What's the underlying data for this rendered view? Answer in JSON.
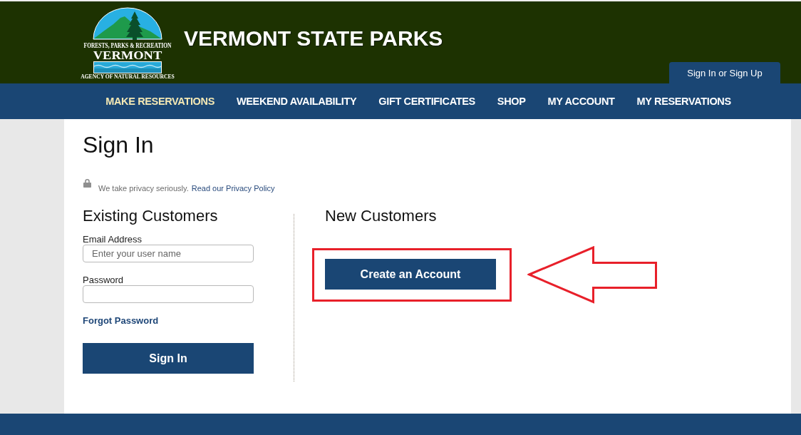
{
  "header": {
    "logo_lines": [
      "FORESTS, PARKS & RECREATION",
      "VERMONT",
      "AGENCY OF NATURAL RESOURCES"
    ],
    "title": "VERMONT STATE PARKS",
    "account_tab": "Sign In or Sign Up"
  },
  "nav": [
    {
      "label": "MAKE RESERVATIONS",
      "selected": true
    },
    {
      "label": "WEEKEND AVAILABILITY",
      "selected": false
    },
    {
      "label": "GIFT CERTIFICATES",
      "selected": false
    },
    {
      "label": "SHOP",
      "selected": false
    },
    {
      "label": "MY ACCOUNT",
      "selected": false
    },
    {
      "label": "MY RESERVATIONS",
      "selected": false
    }
  ],
  "page": {
    "title": "Sign In",
    "privacy_text": "We take privacy seriously.",
    "privacy_link": "Read our Privacy Policy"
  },
  "existing_customers": {
    "heading": "Existing Customers",
    "fields": [
      {
        "label": "Email Address",
        "placeholder": "Enter your user name"
      },
      {
        "label": "Password"
      }
    ],
    "forgot_link": "Forgot Password",
    "button": "Sign In"
  },
  "new_customers": {
    "heading": "New Customers",
    "button": {
      "label": "Create an Account",
      "highlighted": true
    }
  }
}
